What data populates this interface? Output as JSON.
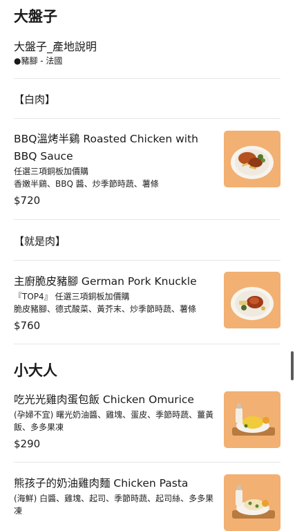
{
  "sections": [
    {
      "title": "大盤子"
    },
    {
      "title": "小大人"
    }
  ],
  "origin": {
    "title": "大盤子_產地說明",
    "line": "●豬腳 - 法國"
  },
  "subheadings": [
    "【白肉】",
    "【就是肉】"
  ],
  "items": [
    {
      "name": "BBQ溫烤半鷄 Roasted Chicken with BBQ Sauce",
      "desc1": "任選三項銅板加價購",
      "desc2": "香嫩半鷄、BBQ 醬、炒季節時蔬、薯條",
      "price": "$720",
      "image": "roasted-chicken-plate"
    },
    {
      "name": "主廚脆皮豬腳 German Pork Knuckle",
      "desc1": "『TOP4』 任選三項銅板加價購",
      "desc2": "脆皮豬腳、德式酸菜、黃芥末、炒季節時蔬、薯條",
      "price": "$760",
      "image": "pork-knuckle-plate"
    },
    {
      "name": "吃光光雞肉蛋包飯 Chicken Omurice",
      "desc1": "(孕婦不宜) 曙光奶油醬、雞塊、蛋皮、季節時蔬、薑黃飯、多多果凍",
      "desc2": "",
      "price": "$290",
      "image": "kids-omurice-tray"
    },
    {
      "name": "熊孩子的奶油雞肉麵 Chicken Pasta",
      "desc1": "(海鮮) 白醬、雞塊、起司、季節時蔬、起司絲、多多果凍",
      "desc2": "",
      "price": "",
      "image": "kids-pasta-tray"
    }
  ],
  "colors": {
    "thumb_bg": "#f2b072",
    "divider": "#e6e6e6"
  }
}
